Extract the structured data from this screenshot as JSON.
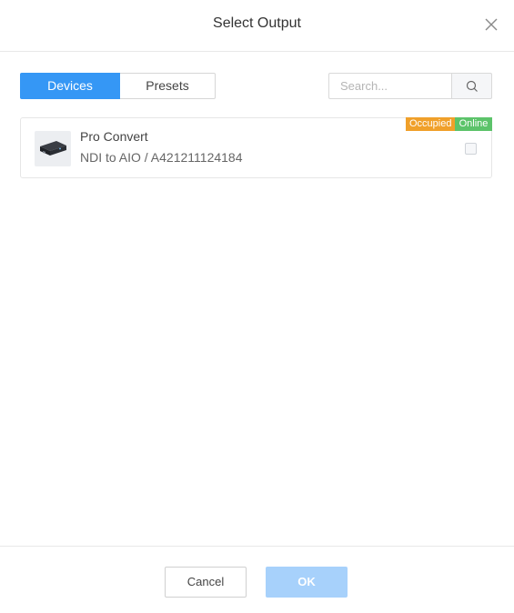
{
  "dialog": {
    "title": "Select Output",
    "close_icon": "close-icon"
  },
  "tabs": [
    {
      "label": "Devices",
      "active": true
    },
    {
      "label": "Presets",
      "active": false
    }
  ],
  "search": {
    "placeholder": "Search...",
    "value": "",
    "icon": "search-icon"
  },
  "devices": [
    {
      "name": "Pro Convert",
      "subtitle": "NDI to AIO / A421211124184",
      "thumbnail_icon": "converter-device-icon",
      "badges": [
        {
          "label": "Occupied",
          "color": "#f0a02a"
        },
        {
          "label": "Online",
          "color": "#5cc36a"
        }
      ],
      "selected": false
    }
  ],
  "footer": {
    "cancel_label": "Cancel",
    "ok_label": "OK"
  },
  "colors": {
    "accent": "#3597f5",
    "ok_disabled": "#a7d1fb",
    "occupied": "#f0a02a",
    "online": "#5cc36a"
  }
}
